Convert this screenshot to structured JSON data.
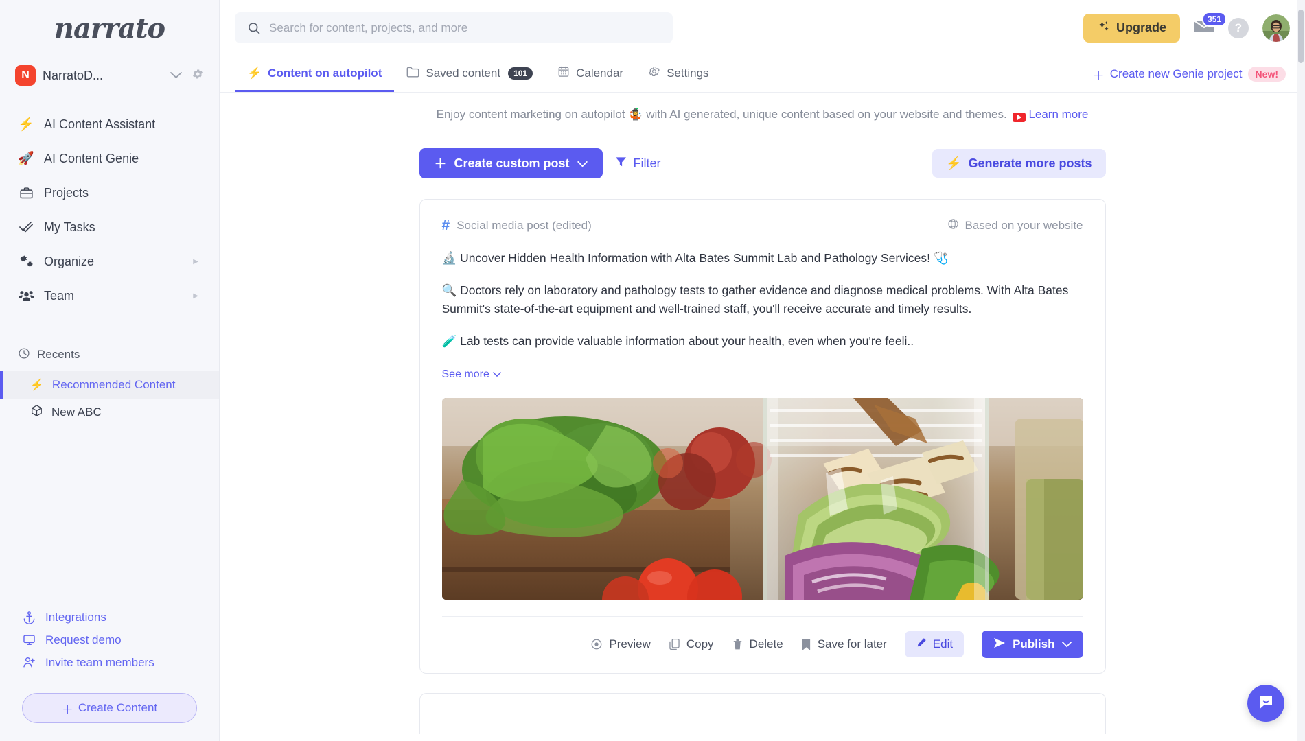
{
  "sidebar": {
    "logo": "narrato",
    "workspace": {
      "initial": "N",
      "name": "NarratoD...",
      "caret": "chevron-down",
      "gear": "gear"
    },
    "nav": [
      {
        "icon": "⚡",
        "label": "AI Content Assistant",
        "arrow": ""
      },
      {
        "icon": "🚀",
        "label": "AI Content Genie",
        "arrow": ""
      },
      {
        "icon": "briefcase",
        "label": "Projects",
        "arrow": ""
      },
      {
        "icon": "check",
        "label": "My Tasks",
        "arrow": ""
      },
      {
        "icon": "gears",
        "label": "Organize",
        "arrow": "▶"
      },
      {
        "icon": "team",
        "label": "Team",
        "arrow": "▶"
      }
    ],
    "recents": {
      "title": "Recents",
      "items": [
        {
          "icon": "⚡",
          "label": "Recommended Content",
          "active": true
        },
        {
          "icon": "cube",
          "label": "New ABC",
          "active": false
        }
      ]
    },
    "bottom_links": [
      {
        "icon": "anchor-icon",
        "label": "Integrations"
      },
      {
        "icon": "monitor-icon",
        "label": "Request demo"
      },
      {
        "icon": "user-plus-icon",
        "label": "Invite team members"
      }
    ],
    "create_content_label": "Create Content"
  },
  "topbar": {
    "search_placeholder": "Search for content, projects, and more",
    "search_value": "",
    "upgrade_label": "Upgrade",
    "mail_badge": "351",
    "help_label": "?"
  },
  "tabs": [
    {
      "label": "Content on autopilot",
      "icon": "⚡",
      "count": "",
      "active": true
    },
    {
      "label": "Saved content",
      "icon": "folder",
      "count": "101",
      "active": false
    },
    {
      "label": "Calendar",
      "icon": "calendar",
      "count": "",
      "active": false
    },
    {
      "label": "Settings",
      "icon": "gear",
      "count": "",
      "active": false
    }
  ],
  "genie_link": {
    "label": "Create new Genie project",
    "badge": "New!"
  },
  "banner": {
    "text_before": "Enjoy content marketing on autopilot 🤹 with AI generated, unique content based on your website and themes.",
    "learn_more": "Learn more"
  },
  "actions": {
    "create_custom_post": "Create custom post",
    "filter": "Filter",
    "generate_more_posts": "Generate more posts"
  },
  "post_card": {
    "type_label": "Social media post (edited)",
    "source_label": "Based on your website",
    "paragraphs": [
      "🔬 Uncover Hidden Health Information with Alta Bates Summit Lab and Pathology Services! 🩺",
      "🔍 Doctors rely on laboratory and pathology tests to gather evidence and diagnose medical problems. With Alta Bates Summit's state-of-the-art equipment and well-trained staff, you'll receive accurate and timely results.",
      "🧪 Lab tests can provide valuable information about your health, even when you're feeli.."
    ],
    "see_more": "See more",
    "image_alt": "mason jar salad with grilled halloumi avocado and greens",
    "buttons": {
      "preview": "Preview",
      "copy": "Copy",
      "delete": "Delete",
      "save_for_later": "Save for later",
      "edit": "Edit",
      "publish": "Publish"
    }
  },
  "colors": {
    "accent": "#5b5bf0",
    "accent_soft": "#e8e9fd",
    "upgrade": "#f4cc67",
    "badge_new": "#fcdde6",
    "workspace_avatar": "#f4442e"
  }
}
